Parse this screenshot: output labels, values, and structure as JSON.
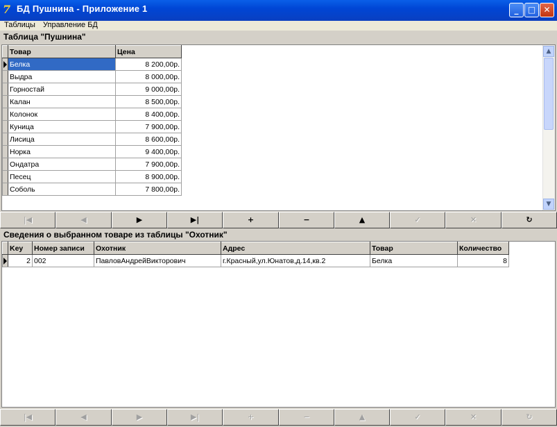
{
  "window": {
    "title": "БД Пушнина - Приложение 1",
    "icon": "app-logo-icon",
    "buttons": [
      "_",
      "□",
      "✕"
    ]
  },
  "menu": [
    "Таблицы",
    "Управление БД"
  ],
  "top_section": {
    "caption": "Таблица \"Пушнина\"",
    "columns": [
      "Товар",
      "Цена"
    ],
    "rows": [
      [
        "Белка",
        "8 200,00р."
      ],
      [
        "Выдра",
        "8 000,00р."
      ],
      [
        "Горностай",
        "9 000,00р."
      ],
      [
        "Калан",
        "8 500,00р."
      ],
      [
        "Колонок",
        "8 400,00р."
      ],
      [
        "Куница",
        "7 900,00р."
      ],
      [
        "Лисица",
        "8 600,00р."
      ],
      [
        "Норка",
        "9 400,00р."
      ],
      [
        "Ондатра",
        "7 900,00р."
      ],
      [
        "Песец",
        "8 900,00р."
      ],
      [
        "Соболь",
        "7 800,00р."
      ]
    ],
    "selected_row": 0
  },
  "bottom_section": {
    "caption": "Сведения о выбранном товаре из таблицы \"Охотник\"",
    "columns": [
      "Key",
      "Номер записи",
      "Охотник",
      "Адрес",
      "Товар",
      "Количество"
    ],
    "rows": [
      [
        "2",
        "002",
        "ПавловАндрейВикторович",
        "г.Красный,ул.Юнатов,д.14,кв.2",
        "Белка",
        "8"
      ]
    ]
  },
  "navigator": {
    "glyphs": [
      "|◀",
      "◀",
      "▶",
      "▶|",
      "+",
      "−",
      "▲",
      "✓",
      "✕",
      "↻"
    ],
    "names": [
      "first",
      "prior",
      "next",
      "last",
      "insert",
      "delete",
      "edit",
      "post",
      "cancel",
      "refresh"
    ],
    "top_enabled": [
      false,
      false,
      true,
      true,
      true,
      true,
      true,
      false,
      false,
      true
    ],
    "bottom_enabled": [
      false,
      false,
      false,
      false,
      false,
      false,
      false,
      false,
      false,
      false
    ]
  }
}
